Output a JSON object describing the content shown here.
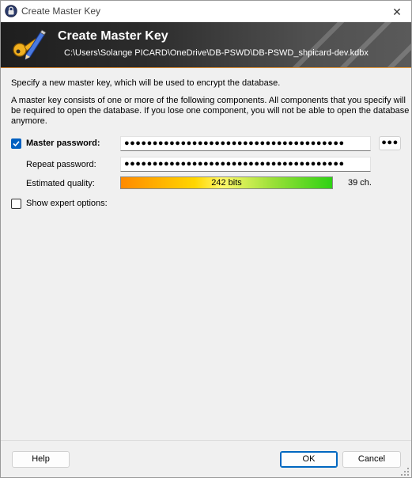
{
  "window": {
    "title": "Create Master Key",
    "close_glyph": "✕"
  },
  "banner": {
    "title": "Create Master Key",
    "path": "C:\\Users\\Solange PICARD\\OneDrive\\DB-PSWD\\DB-PSWD_shpicard-dev.kdbx",
    "icon": "key-pen-icon"
  },
  "intro": {
    "line1": "Specify a new master key, which will be used to encrypt the database.",
    "line2": "A master key consists of one or more of the following components. All components that you specify will",
    "line3": "be required to open the database. If you lose one component, you will not be able to open the database",
    "line4": "anymore."
  },
  "master_password": {
    "label": "Master password:",
    "checked": true,
    "value": "●●●●●●●●●●●●●●●●●●●●●●●●●●●●●●●●●●●●●●●",
    "toggle_label": "●●●"
  },
  "repeat_password": {
    "label": "Repeat password:",
    "value": "●●●●●●●●●●●●●●●●●●●●●●●●●●●●●●●●●●●●●●●"
  },
  "quality": {
    "label": "Estimated quality:",
    "bits_text": "242 bits",
    "chars_text": "39 ch.",
    "fill_fraction": 1.0
  },
  "expert": {
    "label": "Show expert options:",
    "checked": false
  },
  "buttons": {
    "help": "Help",
    "ok": "OK",
    "cancel": "Cancel"
  },
  "colors": {
    "checkbox_accent": "#0060c0",
    "banner_accent": "#e89c3c"
  }
}
